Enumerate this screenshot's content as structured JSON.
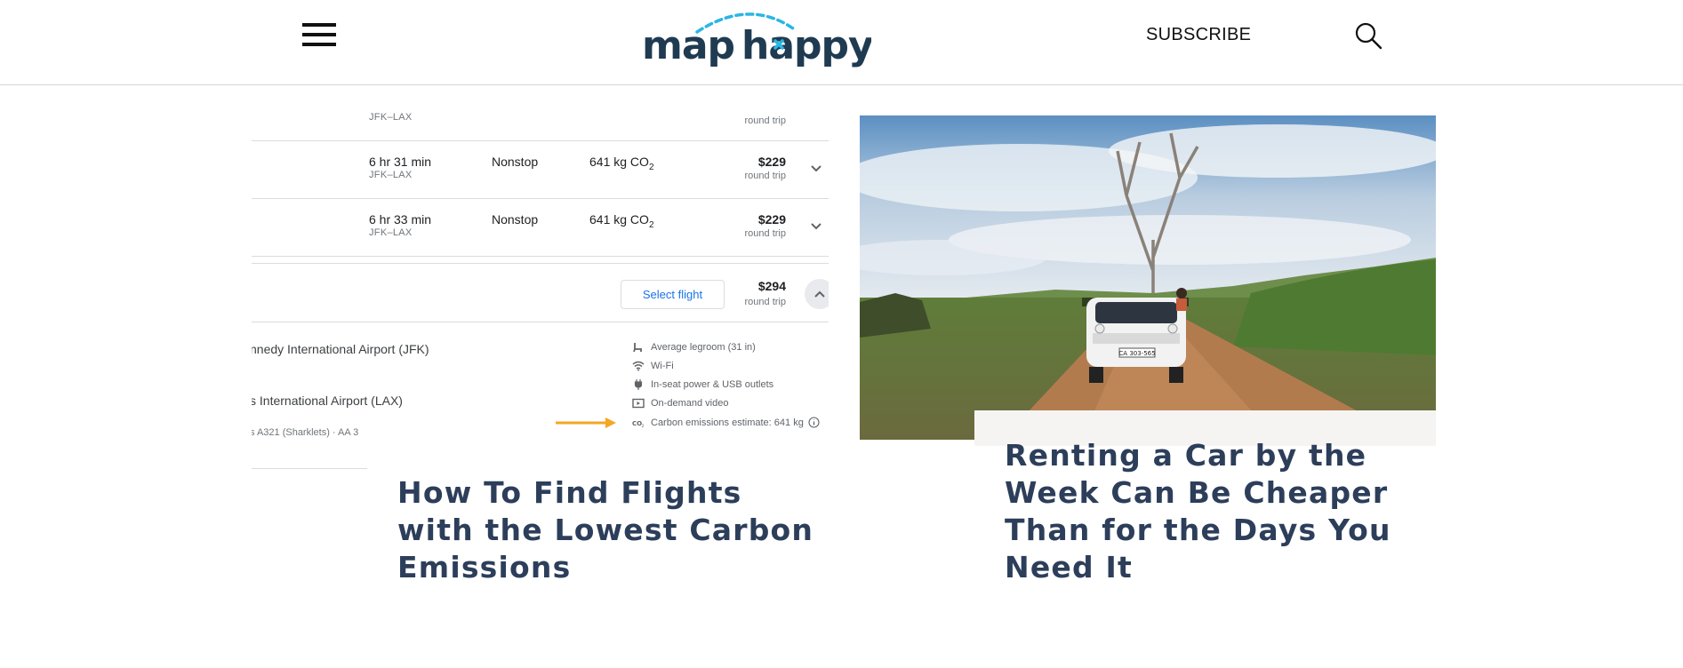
{
  "header": {
    "logo_text": "map happy",
    "subscribe_label": "SUBSCRIBE"
  },
  "card1": {
    "title": "How To Find Flights with the Lowest Carbon Emissions",
    "screenshot": {
      "top_row": {
        "route": "JFK–LAX",
        "trip": "round trip"
      },
      "rows": [
        {
          "duration": "6 hr 31 min",
          "route": "JFK–LAX",
          "stops": "Nonstop",
          "co2": "641 kg CO",
          "co2_sub": "2",
          "price": "$229",
          "trip": "round trip"
        },
        {
          "duration": "6 hr 33 min",
          "route": "JFK–LAX",
          "stops": "Nonstop",
          "co2": "641 kg CO",
          "co2_sub": "2",
          "price": "$229",
          "trip": "round trip"
        }
      ],
      "expanded": {
        "select_label": "Select flight",
        "price": "$294",
        "trip": "round trip",
        "origin": "nnedy International Airport (JFK)",
        "destination": "s International Airport (LAX)",
        "aircraft": "s A321 (Sharklets) · AA 3",
        "amenities": [
          {
            "icon": "seat-icon",
            "label": "Average legroom (31 in)"
          },
          {
            "icon": "wifi-icon",
            "label": "Wi-Fi"
          },
          {
            "icon": "power-plug-icon",
            "label": "In-seat power & USB outlets"
          },
          {
            "icon": "video-icon",
            "label": "On-demand video"
          },
          {
            "icon": "co2-icon",
            "label": "Carbon emissions estimate: 641 kg"
          }
        ],
        "highlight_color": "#f5a623"
      }
    }
  },
  "card2": {
    "title": "Renting a Car by the Week Can Be Cheaper Than for the Days You Need It",
    "plate_text": "CA 303-565"
  },
  "colors": {
    "title": "#2c3e5a",
    "logo_dark": "#1f3b52",
    "logo_accent": "#29b6e6"
  }
}
